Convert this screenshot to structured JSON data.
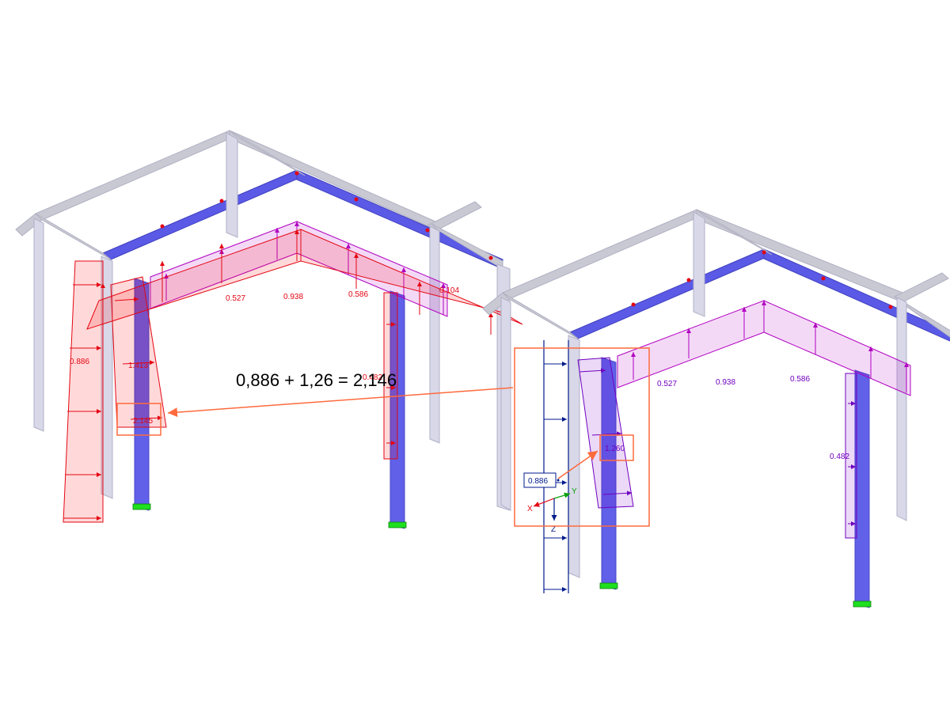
{
  "left": {
    "labels": {
      "l0886": "0.886",
      "l1413": "1.413",
      "l2145": "2.145",
      "l0527": "0.527",
      "l0938": "0.938",
      "l0586": "0.586",
      "l0104": "0.104",
      "l0482": "0.482"
    }
  },
  "right": {
    "labels": {
      "l0886": "0.886",
      "l1260": "1.260",
      "l0527": "0.527",
      "l0938": "0.938",
      "l0586": "0.586",
      "l0482": "0.482"
    },
    "axes": {
      "x": "X",
      "y": "Y",
      "z": "Z"
    }
  },
  "equation": "0,886 + 1,26 = 2,146",
  "colors": {
    "structure_gray": "#c9c9d4",
    "structure_blue": "#5a5ae6",
    "load_red": "#e30613",
    "load_purple": "#7000c0",
    "load_navy": "#001a8c",
    "highlight": "#ff6a3c",
    "support_green": "#1ee01e"
  }
}
